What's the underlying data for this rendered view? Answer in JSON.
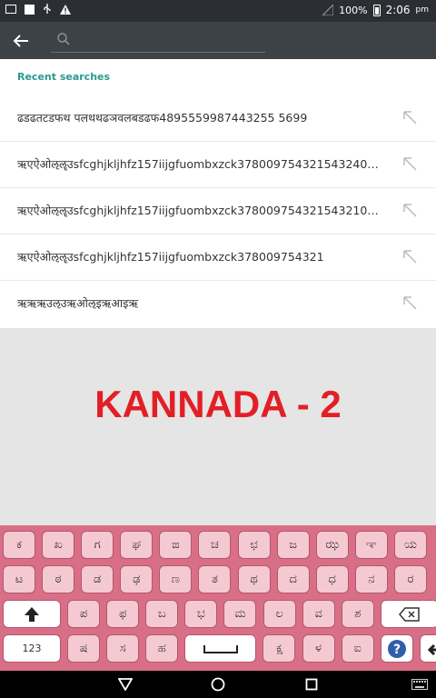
{
  "status_bar": {
    "battery_percent": "100%",
    "time": "2:06",
    "am_pm": "pm"
  },
  "search": {
    "placeholder": "",
    "value": ""
  },
  "recent": {
    "header": "Recent searches",
    "items": [
      "ढडढतटडफथ पलथथढञवलबडढफ4895559987443255 5699",
      "ऋएऐओऌॡउsfcghjkljhfz157iijgfuombxzck378009754321543240…",
      "ऋएऐओऌॡउsfcghjkljhfz157iijgfuombxzck378009754321543210…",
      "ऋएऐओऌॡउsfcghjkljhfz157iijgfuombxzck378009754321",
      "ऋऋऋउऌउऋओऌइऋआइऋ"
    ]
  },
  "banner": {
    "text": "KANNADA - 2"
  },
  "keyboard": {
    "row1": [
      "ಕ",
      "ಖ",
      "ಗ",
      "ಘ",
      "ಙ",
      "ಚ",
      "ಛ",
      "ಜ",
      "ಝ",
      "ಞ",
      "ಯ"
    ],
    "row2": [
      "ಟ",
      "ಠ",
      "ಡ",
      "ಢ",
      "ಣ",
      "ತ",
      "ಥ",
      "ದ",
      "ಧ",
      "ನ",
      "ರ"
    ],
    "row3": [
      "ಪ",
      "ಫ",
      "ಬ",
      "ಭ",
      "ಮ",
      "ಲ",
      "ವ",
      "ಶ"
    ],
    "row4_left": "123",
    "row4_keys_a": [
      "ಷ",
      "ಸ",
      "ಹ"
    ],
    "row4_keys_b": [
      "ಕ್ಷ",
      "ಳ",
      "ಐ"
    ],
    "colors": {
      "board": "#d96f86",
      "key": "#f4c9d1",
      "key_border": "#b5566d"
    }
  }
}
